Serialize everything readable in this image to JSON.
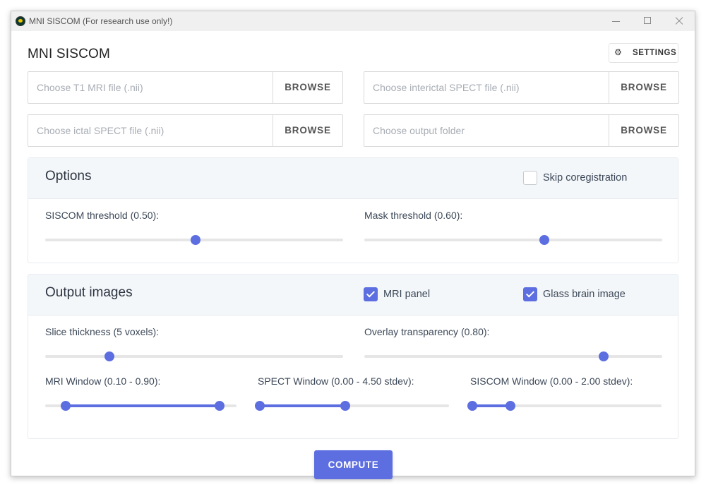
{
  "window": {
    "title": "MNI SISCOM (For research use only!)"
  },
  "header": {
    "page_title": "MNI SISCOM",
    "settings_label": "SETTINGS"
  },
  "files": {
    "t1_placeholder": "Choose T1 MRI file (.nii)",
    "interictal_placeholder": "Choose interictal SPECT file (.nii)",
    "ictal_placeholder": "Choose ictal SPECT file (.nii)",
    "output_placeholder": "Choose output folder",
    "browse_label": "BROWSE"
  },
  "options": {
    "title": "Options",
    "skip_coregistration": {
      "label": "Skip coregistration",
      "checked": false
    },
    "siscom_threshold": {
      "label": "SISCOM threshold (0.50):",
      "value": 0.5
    },
    "mask_threshold": {
      "label": "Mask threshold (0.60):",
      "value": 0.6
    }
  },
  "output_images": {
    "title": "Output images",
    "mri_panel": {
      "label": "MRI panel",
      "checked": true
    },
    "glass_brain": {
      "label": "Glass brain image",
      "checked": true
    },
    "slice_thickness": {
      "label": "Slice thickness (5 voxels):",
      "value": 5
    },
    "overlay_transparency": {
      "label": "Overlay transparency (0.80):",
      "value": 0.8
    },
    "mri_window": {
      "label": "MRI Window (0.10 - 0.90):",
      "low": 0.1,
      "high": 0.9
    },
    "spect_window": {
      "label": "SPECT Window (0.00 - 4.50 stdev):",
      "low": 0.0,
      "high": 4.5
    },
    "siscom_window": {
      "label": "SISCOM Window (0.00 - 2.00 stdev):",
      "low": 0.0,
      "high": 2.0
    }
  },
  "actions": {
    "compute_label": "COMPUTE"
  },
  "colors": {
    "accent": "#5c6ee0"
  }
}
